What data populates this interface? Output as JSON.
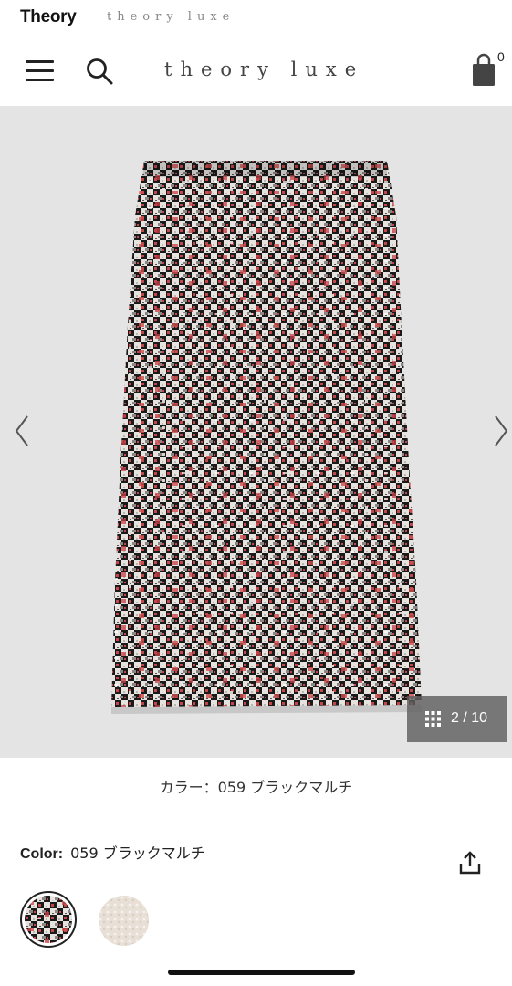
{
  "brand": {
    "theory": "Theory",
    "luxe": "theory luxe"
  },
  "header": {
    "logo": "theory luxe",
    "cart_count": "0"
  },
  "gallery": {
    "counter": "2 / 10",
    "current_index": 2,
    "total": 10,
    "product_colors": {
      "black": "#151515",
      "white": "#e8e6e3",
      "red": "#c2474a",
      "background": "#e4e4e4"
    }
  },
  "product": {
    "color_caption": "カラー：059 ブラックマルチ",
    "color_label": "Color:",
    "color_value": "059 ブラックマルチ"
  },
  "swatches": [
    {
      "name": "black-multi",
      "selected": true,
      "color": "#3a3636"
    },
    {
      "name": "ivory",
      "selected": false,
      "color": "#e9e1d9"
    }
  ],
  "icons": {
    "menu": "hamburger-icon",
    "search": "search-icon",
    "cart": "shopping-bag-icon",
    "prev": "chevron-left-icon",
    "next": "chevron-right-icon",
    "grid": "grid-icon",
    "share": "share-icon"
  }
}
